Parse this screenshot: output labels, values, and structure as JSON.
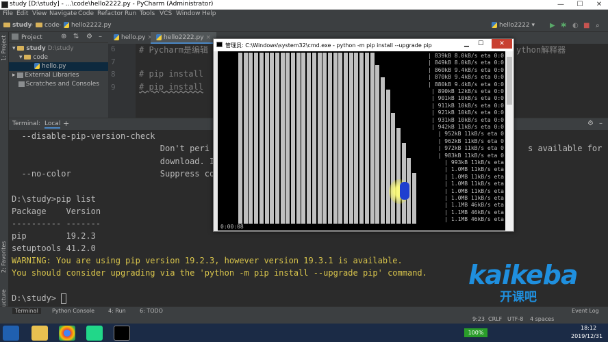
{
  "window": {
    "title": "study [D:\\study] - ...\\code\\hello2222.py - PyCharm (Administrator)",
    "controls": [
      "—",
      "☐",
      "✕"
    ]
  },
  "menu": [
    "File",
    "Edit",
    "View",
    "Navigate",
    "Code",
    "Refactor",
    "Run",
    "Tools",
    "VCS",
    "Window",
    "Help"
  ],
  "nav": {
    "crumbs": [
      "study",
      "code",
      "hello2222.py"
    ],
    "run_config": "hello2222"
  },
  "sidestrip": {
    "project": "1: Project",
    "favorites": "2: Favorites",
    "structure": "Z: Structure"
  },
  "project_panel": {
    "title": "Project",
    "items": [
      {
        "label": "study",
        "extra": "D:\\study"
      },
      {
        "label": "code"
      },
      {
        "label": "hello.py"
      },
      {
        "label": "External Libraries"
      },
      {
        "label": "Scratches and Consoles"
      }
    ]
  },
  "editor": {
    "tabs": [
      "hello.py",
      "hello2222.py"
    ],
    "line_numbers": [
      "6",
      "7",
      "8",
      "9"
    ],
    "lines": [
      "# Pycharm是编辑",
      "# pip install",
      "# pip install"
    ],
    "overflow_text": "ython解释器"
  },
  "terminal": {
    "label": "Terminal:",
    "tab": "Local",
    "add": "+",
    "lines": [
      "  --disable-pip-version-check",
      "                              Don't peri",
      "                              download. I",
      "  --no-color                  Suppress co",
      "",
      "D:\\study>pip list",
      "Package    Version",
      "---------- -------",
      "pip        19.2.3",
      "setuptools 41.2.0",
      "WARNING: You are using pip version 19.2.3, however version 19.3.1 is available.",
      "You should consider upgrading via the 'python -m pip install --upgrade pip' command.",
      "",
      "D:\\study>"
    ],
    "overflow_line": "s available for"
  },
  "cmd": {
    "title": "管理员: C:\\Windows\\system32\\cmd.exe - python  -m pip install --upgrade pip",
    "progress": [
      "839kB 8.0kB/s eta 0:0",
      "849kB 8.0kB/s eta 0:0",
      "860kB 9.4kB/s eta 0:0",
      "870kB 9.4kB/s eta 0:0",
      "880kB 9.4kB/s eta 0:0",
      "890kB 12kB/s eta 0:0",
      "901kB 10kB/s eta 0:0",
      "911kB 10kB/s eta 0:0",
      "921kB 10kB/s eta 0:0",
      "931kB 10kB/s eta 0:0",
      "942kB 11kB/s eta 0:0",
      "952kB 11kB/s eta 0",
      "962kB 11kB/s eta 0",
      "972kB 11kB/s eta 0",
      "983kB 11kB/s eta 0",
      "993kB 11kB/s eta",
      "1.0MB 11kB/s eta",
      "1.0MB 11kB/s eta",
      "1.0MB 11kB/s eta",
      "1.0MB 11kB/s eta",
      "1.0MB 11kB/s eta",
      "1.1MB 46kB/s eta",
      "1.1MB 46kB/s eta",
      "1.1MB 46kB/s eta"
    ],
    "timer": "0:00:08"
  },
  "bottom_tabs": [
    "Terminal",
    "Python Console",
    "4: Run",
    "6: TODO"
  ],
  "event_log": "Event Log",
  "status": {
    "position": "9:23",
    "line_sep": "CRLF",
    "encoding": "UTF-8",
    "indent": "4 spaces"
  },
  "clock": {
    "time": "18:12",
    "date": "2019/12/31"
  },
  "taskbar": {
    "battery": "100%"
  },
  "logo": {
    "brand": "kaikeba",
    "cn": "开课吧"
  },
  "colors": {
    "accent": "#4a88c7",
    "warning": "#d9c54c",
    "logo": "#1f8fde"
  }
}
